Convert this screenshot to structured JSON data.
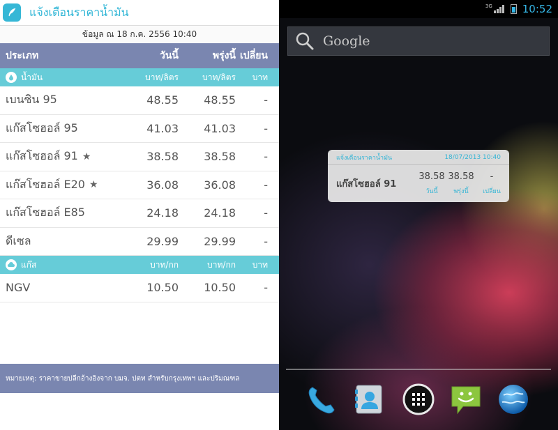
{
  "app": {
    "title": "แจ้งเตือนราคาน้ำมัน",
    "date_line": "ข้อมูล ณ 18 ก.ค. 2556 10:40",
    "header": {
      "type": "ประเภท",
      "today": "วันนี้",
      "tomorrow": "พรุ่งนี้",
      "change": "เปลี่ยน"
    },
    "oil_section": {
      "label": "น้ำมัน",
      "unit_today": "บาท/ลิตร",
      "unit_tomorrow": "บาท/ลิตร",
      "unit_change": "บาท"
    },
    "oil_rows": [
      {
        "name": "เบนซิน 95",
        "today": "48.55",
        "tomorrow": "48.55",
        "change": "-",
        "starred": false
      },
      {
        "name": "แก๊สโซฮอล์ 95",
        "today": "41.03",
        "tomorrow": "41.03",
        "change": "-",
        "starred": false
      },
      {
        "name": "แก๊สโซฮอล์ 91",
        "today": "38.58",
        "tomorrow": "38.58",
        "change": "-",
        "starred": true
      },
      {
        "name": "แก๊สโซฮอล์ E20",
        "today": "36.08",
        "tomorrow": "36.08",
        "change": "-",
        "starred": true
      },
      {
        "name": "แก๊สโซฮอล์ E85",
        "today": "24.18",
        "tomorrow": "24.18",
        "change": "-",
        "starred": false
      },
      {
        "name": "ดีเซล",
        "today": "29.99",
        "tomorrow": "29.99",
        "change": "-",
        "starred": false
      }
    ],
    "gas_section": {
      "label": "แก๊ส",
      "unit_today": "บาท/กก",
      "unit_tomorrow": "บาท/กก",
      "unit_change": "บาท"
    },
    "gas_rows": [
      {
        "name": "NGV",
        "today": "10.50",
        "tomorrow": "10.50",
        "change": "-"
      }
    ],
    "footer": "หมายเหตุ: ราคาขายปลีกอ้างอิงจาก บมจ. ปตท สำหรับกรุงเทพฯ และปริมณฑล",
    "star_glyph": "★"
  },
  "home": {
    "status": {
      "network": "3G",
      "time": "10:52"
    },
    "search_label": "Google",
    "widget": {
      "title": "แจ้งเตือนราคาน้ำมัน",
      "datetime": "18/07/2013 10:40",
      "fuel": "แก๊สโซฮอล์ 91",
      "today": "38.58",
      "tomorrow": "38.58",
      "change": "-",
      "label_today": "วันนี้",
      "label_tomorrow": "พรุ่งนี้",
      "label_change": "เปลี่ยน"
    },
    "dock": [
      "phone-icon",
      "contacts-icon",
      "app-drawer-icon",
      "messaging-icon",
      "browser-icon"
    ]
  },
  "colors": {
    "accent": "#35b5e5",
    "header_bar": "#7a86b0",
    "section_bar": "#66ccd8"
  }
}
